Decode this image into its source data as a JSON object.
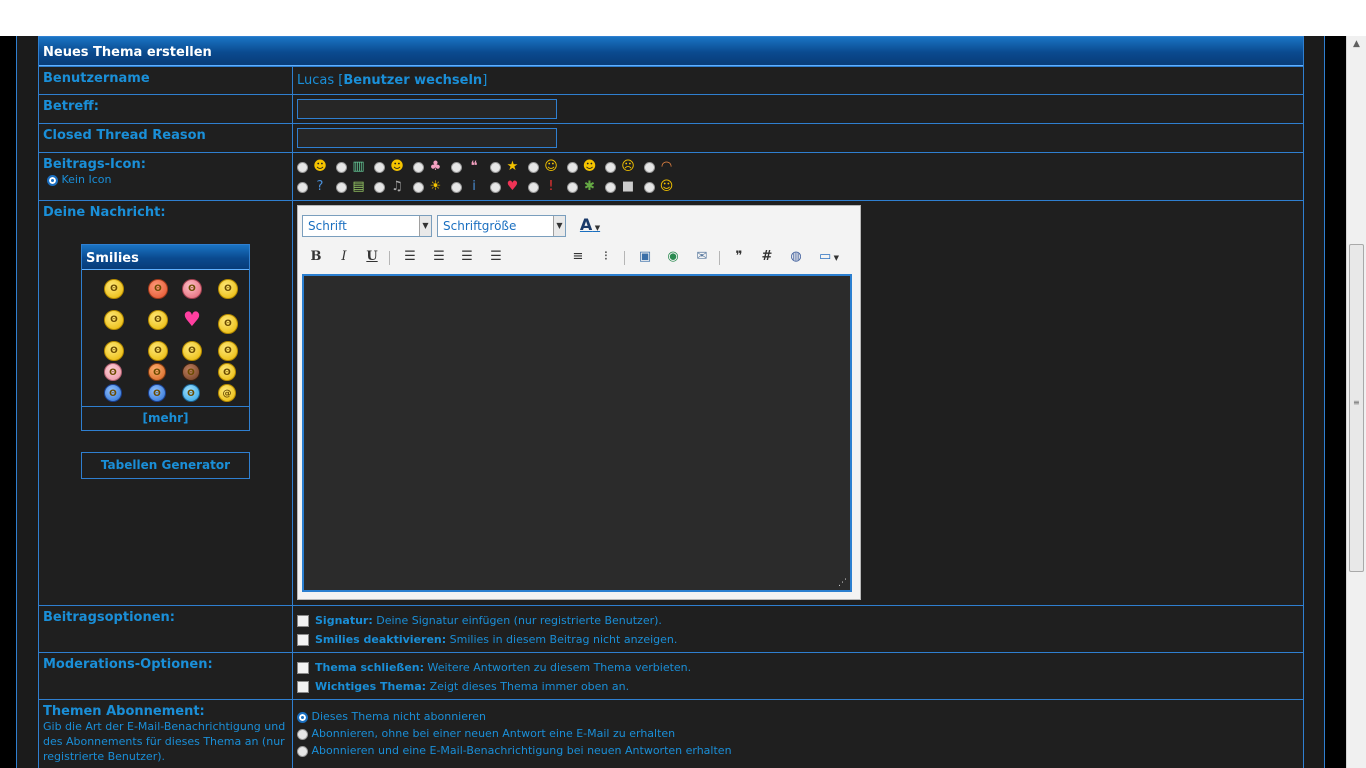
{
  "form": {
    "title": "Neues Thema erstellen",
    "username": {
      "label": "Benutzername",
      "value": "Lucas",
      "change_prefix": "[",
      "change_link": "Benutzer wechseln",
      "change_suffix": "]"
    },
    "subject": {
      "label": "Betreff:",
      "value": ""
    },
    "closed_reason": {
      "label": "Closed Thread Reason",
      "value": ""
    },
    "post_icon": {
      "label": "Beitrags-Icon:",
      "no_icon": "Kein Icon"
    },
    "message": {
      "label": "Deine Nachricht:"
    },
    "editor": {
      "font_select": "Schrift",
      "size_select": "Schriftgröße",
      "text_color": "A",
      "bold": "B",
      "italic": "I",
      "underline": "U",
      "hash": "#"
    },
    "smilies": {
      "title": "Smilies",
      "more": "[mehr]"
    },
    "table_generator": "Tabellen Generator",
    "post_options": {
      "label": "Beitragsoptionen:",
      "signature_title": "Signatur:",
      "signature_desc": "Deine Signatur einfügen (nur registrierte Benutzer).",
      "disable_smilies_title": "Smilies deaktivieren:",
      "disable_smilies_desc": "Smilies in diesem Beitrag nicht anzeigen."
    },
    "mod_options": {
      "label": "Moderations-Optionen:",
      "close_title": "Thema schließen:",
      "close_desc": "Weitere Antworten zu diesem Thema verbieten.",
      "sticky_title": "Wichtiges Thema:",
      "sticky_desc": "Zeigt dieses Thema immer oben an."
    },
    "subscription": {
      "label": "Themen Abonnement:",
      "desc": "Gib die Art der E-Mail-Benachrichtigung und des Abonnements für dieses Thema an (nur registrierte Benutzer).",
      "opt1": "Dieses Thema nicht abonnieren",
      "opt2": "Abonnieren, ohne bei einer neuen Antwort eine E-Mail zu erhalten",
      "opt3": "Abonnieren und eine E-Mail-Benachrichtigung bei neuen Antworten erhalten"
    }
  },
  "colors": {
    "accent": "#1a8fd8",
    "border": "#2f7fd0",
    "background": "#1b1b1b"
  }
}
